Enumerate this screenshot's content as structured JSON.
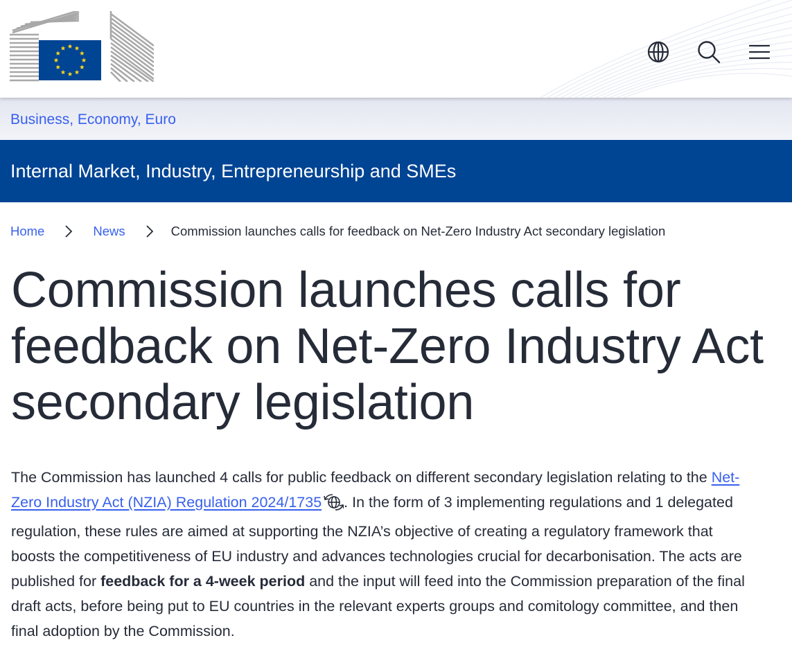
{
  "header": {
    "logo_alt": "European Commission",
    "icons": {
      "language": "globe-icon",
      "search": "search-icon",
      "menu": "hamburger-menu-icon"
    },
    "colors": {
      "flag_blue": "#004494",
      "flag_stars": "#ffd617"
    }
  },
  "site_band": {
    "site_name": "Business, Economy, Euro"
  },
  "dg_bar": {
    "title": "Internal Market, Industry, Entrepreneurship and SMEs",
    "color": "#004494"
  },
  "breadcrumb": {
    "items": [
      {
        "label": "Home"
      },
      {
        "label": "News"
      }
    ],
    "current": "Commission launches calls for feedback on Net-Zero Industry Act secondary legislation"
  },
  "page": {
    "title": "Commission launches calls for feedback on Net-Zero Industry Act secondary legislation"
  },
  "article": {
    "p1_before_link": "The Commission has launched 4 calls for public feedback on different secondary legislation relating to the ",
    "link_text": "Net-Zero Industry Act (NZIA) Regulation 2024/1735",
    "link_icon": "external-globe-link-icon",
    "p1_after_link": ". In the form of 3 implementing regulations and 1 delegated regulation, these rules are aimed at supporting the NZIA’s objective of creating a regulatory framework that boosts the competitiveness of EU industry and advances technologies crucial for decarbonisation. The acts are published for ",
    "bold_text": "feedback for a 4-week period",
    "p1_end": " and the input will feed into the Commission preparation of the final draft acts, before being put to EU countries in the relevant experts groups and comitology committee, and then final adoption by the Commission."
  },
  "colors": {
    "link": "#3860ed",
    "text": "#262b38"
  }
}
